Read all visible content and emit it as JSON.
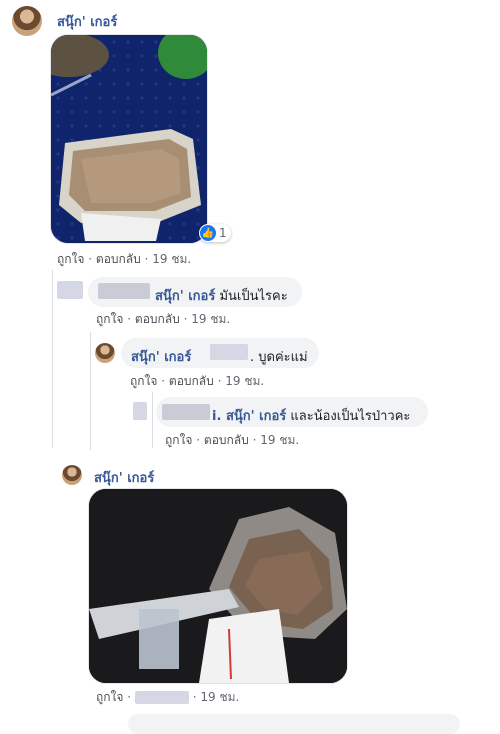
{
  "comments": [
    {
      "author": "สนุ๊ก' เกอร์",
      "has_photo": true,
      "reactions": {
        "icon": "like-icon",
        "count": "1"
      },
      "actions": {
        "like": "ถูกใจ",
        "reply": "ตอบกลับ",
        "time": "19 ชม."
      }
    },
    {
      "mention": "สนุ๊ก' เกอร์",
      "text": "มันเป็นไรคะ",
      "actions": {
        "like": "ถูกใจ",
        "reply": "ตอบกลับ",
        "time": "19 ชม."
      }
    },
    {
      "author": "สนุ๊ก' เกอร์",
      "text": ". บูดค่ะแม่",
      "actions": {
        "like": "ถูกใจ",
        "reply": "ตอบกลับ",
        "time": "19 ชม."
      }
    },
    {
      "mention_prefix": "i.",
      "mention": "สนุ๊ก' เกอร์",
      "text": "และน้องเป็นไรป่าวคะ",
      "actions": {
        "like": "ถูกใจ",
        "reply": "ตอบกลับ",
        "time": "19 ชม."
      }
    },
    {
      "author": "สนุ๊ก' เกอร์",
      "has_photo": true,
      "actions": {
        "like": "ถูกใจ",
        "time": "19 ชม."
      }
    }
  ],
  "separator": "·",
  "colors": {
    "link": "#385898",
    "bubble": "#f2f3f5",
    "like": "#1877f2"
  }
}
